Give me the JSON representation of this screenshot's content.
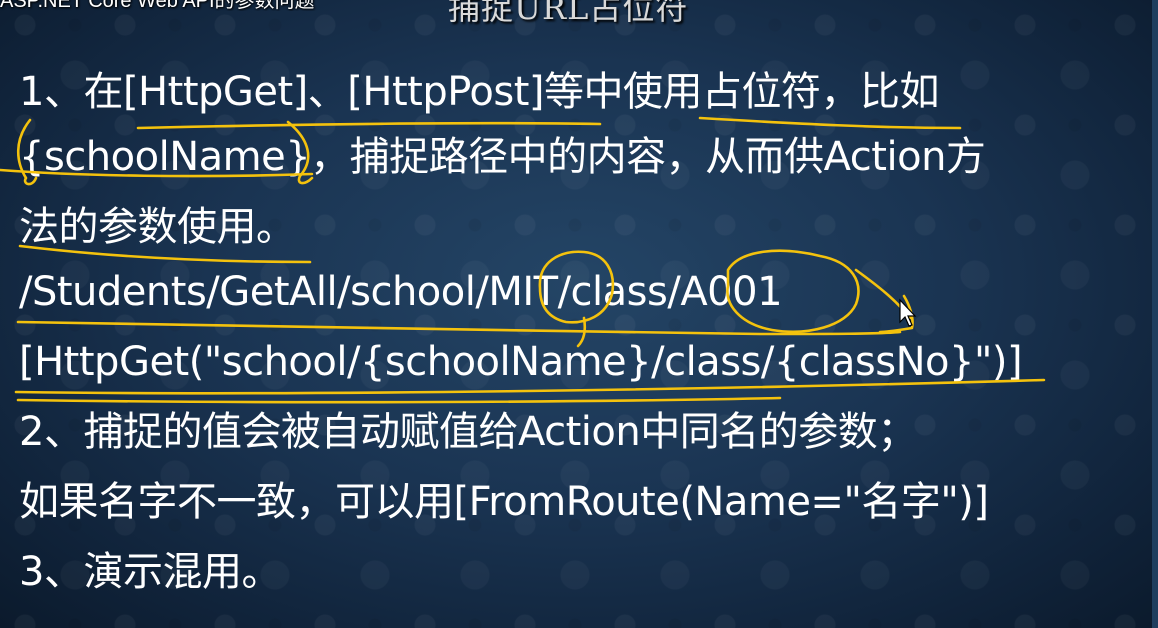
{
  "window": {
    "title": "ASP.NET Core Web API的参数问题"
  },
  "slide": {
    "title": "捕捉URL占位符",
    "lines": [
      "1、在[HttpGet]、[HttpPost]等中使用占位符，比如",
      "{schoolName}，捕捉路径中的内容，从而供Action方",
      "法的参数使用。",
      "/Students/GetAll/school/MIT/class/A001",
      "[HttpGet(\"school/{schoolName}/class/{classNo}\")]",
      "2、捕捉的值会被自动赋值给Action中同名的参数；",
      "如果名字不一致，可以用[FromRoute(Name=\"名字\")]",
      "3、演示混用。"
    ]
  },
  "annotation": {
    "color": "#f4c20d"
  },
  "icons": {
    "cursor": "mouse-pointer-icon"
  }
}
